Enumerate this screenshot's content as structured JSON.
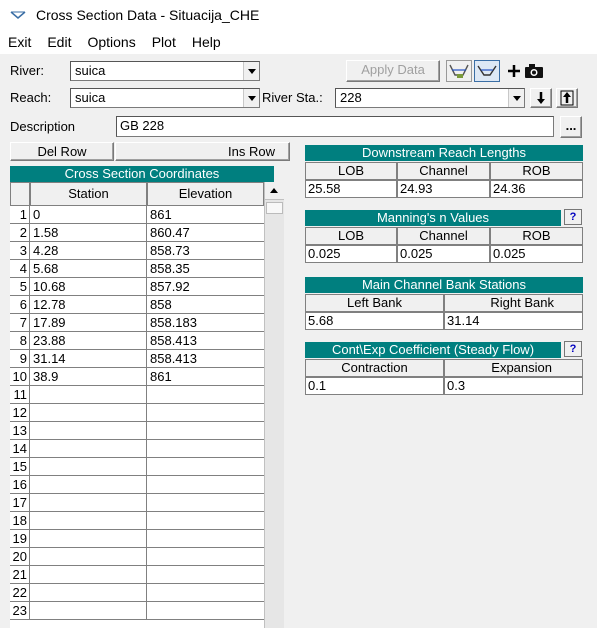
{
  "window": {
    "title": "Cross Section Data - Situacija_CHE"
  },
  "menu": [
    "Exit",
    "Edit",
    "Options",
    "Plot",
    "Help"
  ],
  "river": {
    "label": "River:",
    "value": "suica"
  },
  "reach": {
    "label": "Reach:",
    "value": "suica"
  },
  "river_sta": {
    "label": "River Sta.:",
    "value": "228"
  },
  "apply_data": "Apply Data",
  "description": {
    "label": "Description",
    "value": "GB 228",
    "browse": "..."
  },
  "buttons": {
    "del_row": "Del Row",
    "ins_row": "Ins Row"
  },
  "grid": {
    "title": "Cross Section Coordinates",
    "headers": [
      "Station",
      "Elevation"
    ],
    "rows": [
      {
        "idx": "1",
        "station": "0",
        "elevation": "861"
      },
      {
        "idx": "2",
        "station": "1.58",
        "elevation": "860.47"
      },
      {
        "idx": "3",
        "station": "4.28",
        "elevation": "858.73"
      },
      {
        "idx": "4",
        "station": "5.68",
        "elevation": "858.35"
      },
      {
        "idx": "5",
        "station": "10.68",
        "elevation": "857.92"
      },
      {
        "idx": "6",
        "station": "12.78",
        "elevation": "858"
      },
      {
        "idx": "7",
        "station": "17.89",
        "elevation": "858.183"
      },
      {
        "idx": "8",
        "station": "23.88",
        "elevation": "858.413"
      },
      {
        "idx": "9",
        "station": "31.14",
        "elevation": "858.413"
      },
      {
        "idx": "10",
        "station": "38.9",
        "elevation": "861"
      },
      {
        "idx": "11",
        "station": "",
        "elevation": ""
      },
      {
        "idx": "12",
        "station": "",
        "elevation": ""
      },
      {
        "idx": "13",
        "station": "",
        "elevation": ""
      },
      {
        "idx": "14",
        "station": "",
        "elevation": ""
      },
      {
        "idx": "15",
        "station": "",
        "elevation": ""
      },
      {
        "idx": "16",
        "station": "",
        "elevation": ""
      },
      {
        "idx": "17",
        "station": "",
        "elevation": ""
      },
      {
        "idx": "18",
        "station": "",
        "elevation": ""
      },
      {
        "idx": "19",
        "station": "",
        "elevation": ""
      },
      {
        "idx": "20",
        "station": "",
        "elevation": ""
      },
      {
        "idx": "21",
        "station": "",
        "elevation": ""
      },
      {
        "idx": "22",
        "station": "",
        "elevation": ""
      },
      {
        "idx": "23",
        "station": "",
        "elevation": ""
      }
    ]
  },
  "reach_lengths": {
    "title": "Downstream Reach Lengths",
    "headers": [
      "LOB",
      "Channel",
      "ROB"
    ],
    "values": [
      "25.58",
      "24.93",
      "24.36"
    ]
  },
  "mannings": {
    "title": "Manning's n Values",
    "headers": [
      "LOB",
      "Channel",
      "ROB"
    ],
    "values": [
      "0.025",
      "0.025",
      "0.025"
    ]
  },
  "bank_stations": {
    "title": "Main Channel Bank Stations",
    "headers": [
      "Left Bank",
      "Right Bank"
    ],
    "values": [
      "5.68",
      "31.14"
    ]
  },
  "cont_exp": {
    "title": "Cont\\Exp Coefficient (Steady Flow)",
    "headers": [
      "Contraction",
      "Expansion"
    ],
    "values": [
      "0.1",
      "0.3"
    ]
  },
  "help_glyph": "?"
}
